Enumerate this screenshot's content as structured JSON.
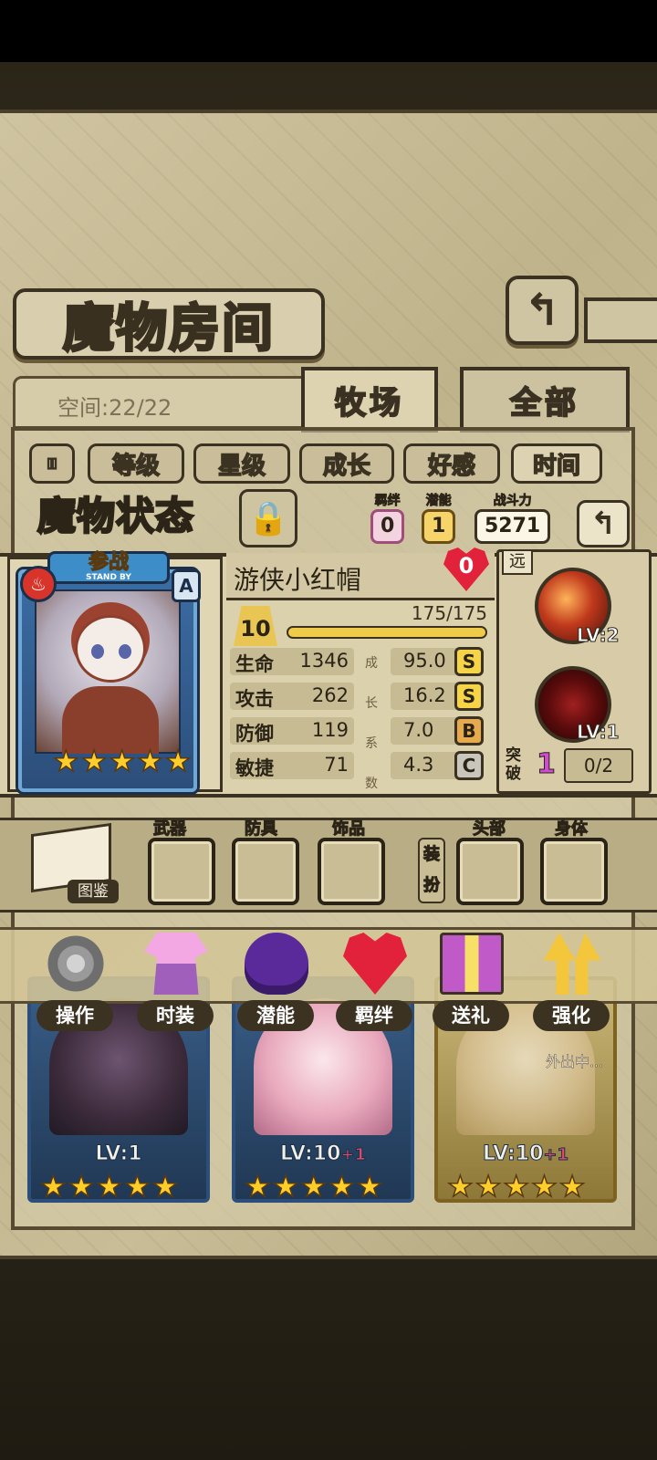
{
  "header": {
    "title": "魔物房间",
    "space_label": "空间:22/22",
    "tabs": [
      {
        "label": "牧场",
        "active": true
      },
      {
        "label": "全部",
        "active": false
      }
    ]
  },
  "sort_buttons": [
    {
      "label": "等级",
      "active": false
    },
    {
      "label": "星级",
      "active": false
    },
    {
      "label": "成长",
      "active": false
    },
    {
      "label": "好感",
      "active": false
    },
    {
      "label": "时间",
      "active": true
    }
  ],
  "status": {
    "title": "魔物状态",
    "bond_label": "羁绊",
    "bond_value": "0",
    "potential_label": "潜能",
    "potential_value": "1",
    "power_label": "战斗力",
    "power_value": "5271"
  },
  "monster": {
    "standby_cn": "参战",
    "standby_en": "STAND BY",
    "rank": "A",
    "stars": 5,
    "name": "游侠小红帽",
    "affection": "0",
    "level": "10",
    "exp_text": "175/175",
    "exp_fraction": 1.0,
    "range": "远",
    "growth_label": [
      "成",
      "长",
      "系",
      "数"
    ],
    "stats": [
      {
        "label": "生命",
        "value": "1346",
        "growth": "95.0",
        "grade": "S"
      },
      {
        "label": "攻击",
        "value": "262",
        "growth": "16.2",
        "grade": "S"
      },
      {
        "label": "防御",
        "value": "119",
        "growth": "7.0",
        "grade": "B"
      },
      {
        "label": "敏捷",
        "value": "71",
        "growth": "4.3",
        "grade": "C"
      }
    ],
    "skills": [
      {
        "level": "LV:2"
      },
      {
        "level": "LV:1"
      }
    ],
    "breakthrough_label": "突破",
    "breakthrough_value": "1",
    "breakthrough_progress": "0/2"
  },
  "equipment": {
    "handbook_label": "图鉴",
    "dress_label": "装扮",
    "slots": [
      "武器",
      "防具",
      "饰品",
      "头部",
      "身体"
    ]
  },
  "actions": [
    "操作",
    "时装",
    "潜能",
    "羁绊",
    "送礼",
    "强化"
  ],
  "list_cards": [
    {
      "level": "LV:1",
      "plus": ""
    },
    {
      "level": "LV:10",
      "plus": "+1"
    },
    {
      "level": "LV:10",
      "plus": "+1",
      "status": "外出中..."
    }
  ],
  "colors": {
    "accent": "#f0cb4a",
    "card_blue": "#3b6da3",
    "heart_red": "#e2223b"
  }
}
